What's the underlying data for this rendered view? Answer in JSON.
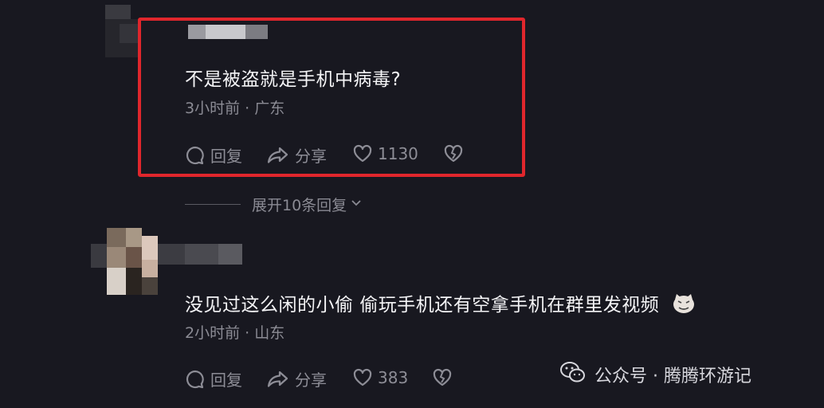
{
  "comments": [
    {
      "text": "不是被盗就是手机中病毒?",
      "meta": "3小时前 · 广东",
      "reply_label": "回复",
      "share_label": "分享",
      "like_count": "1130"
    },
    {
      "text": "没见过这么闲的小偷 偷玩手机还有空拿手机在群里发视频",
      "emoji": "cat-face-emoji",
      "meta": "2小时前 · 山东",
      "reply_label": "回复",
      "share_label": "分享",
      "like_count": "383"
    }
  ],
  "expand_replies": "展开10条回复",
  "watermark": {
    "text": "公众号 · 腾腾环游记",
    "icon": "wechat-icon"
  },
  "colors": {
    "background": "#181820",
    "highlight_border": "#e0262c",
    "text": "#f4f4f6",
    "muted": "#8b8b94"
  }
}
